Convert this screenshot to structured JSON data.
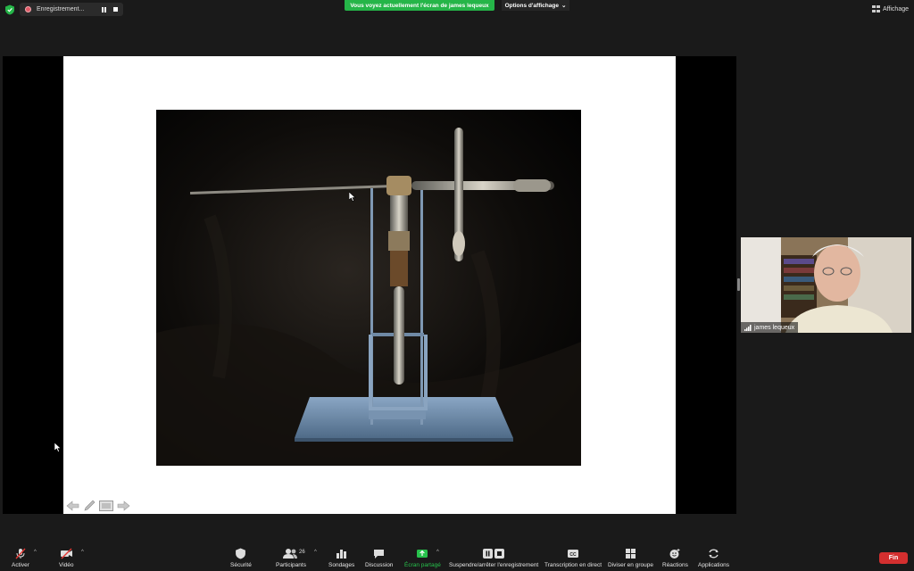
{
  "recording": {
    "label": "Enregistrement..."
  },
  "banner": {
    "text": "Vous voyez actuellement l'écran de james lequeux"
  },
  "view_options": {
    "label": "Options d'affichage"
  },
  "view_button": {
    "label": "Affichage"
  },
  "participant": {
    "name": "james lequeux"
  },
  "toolbar": {
    "mute": "Activer",
    "video": "Vidéo",
    "security": "Sécurité",
    "participants": "Participants",
    "participants_count": "26",
    "polls": "Sondages",
    "chat": "Discussion",
    "share": "Écran partagé",
    "record": "Suspendre/arrêter l'enregistrement",
    "transcript": "Transcription en direct",
    "breakout": "Diviser en groupe",
    "reactions": "Réactions",
    "apps": "Applications",
    "end": "Fin"
  },
  "colors": {
    "accent_green": "#25b548",
    "end_red": "#d32f2f",
    "background": "#1a1a1a"
  }
}
